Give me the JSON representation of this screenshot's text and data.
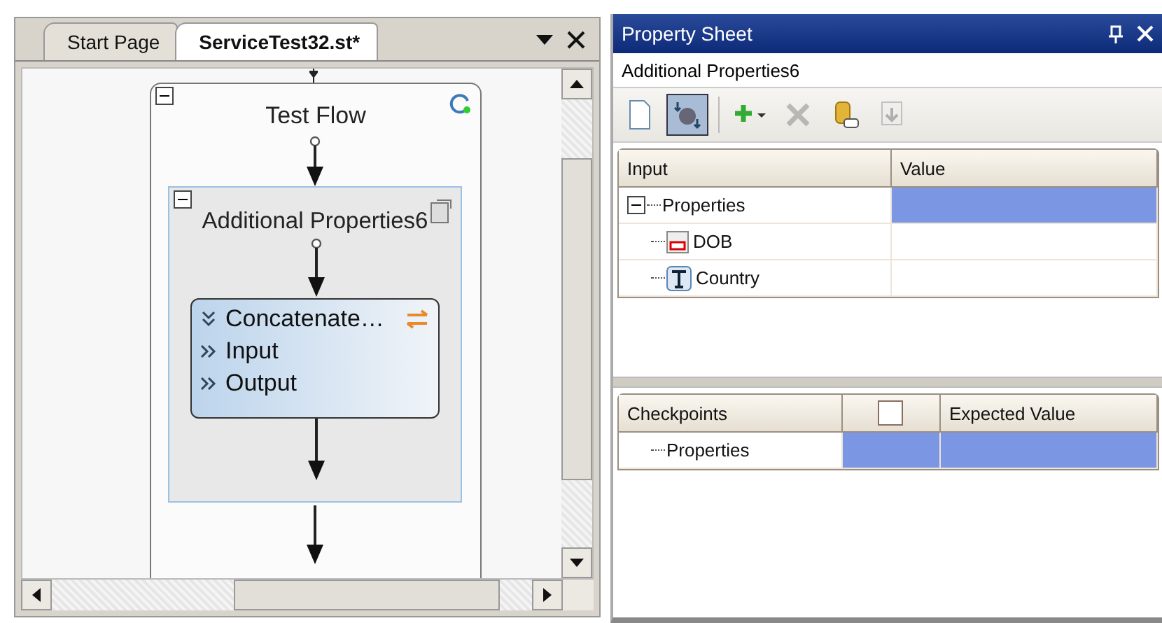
{
  "document_tabs": {
    "tabs": [
      {
        "label": "Start Page",
        "selected": false
      },
      {
        "label": "ServiceTest32.st*",
        "selected": true
      }
    ]
  },
  "diagram": {
    "flow": {
      "title": "Test Flow",
      "expanded": true
    },
    "group": {
      "title": "Additional Properties6",
      "expanded": true
    },
    "activity": {
      "title": "Concatenate…",
      "sections": [
        "Input",
        "Output"
      ]
    }
  },
  "property_sheet": {
    "title": "Property Sheet",
    "object_name": "Additional Properties6",
    "toolbar": [
      {
        "kind": "new",
        "pressed": false,
        "disabled": false
      },
      {
        "kind": "map",
        "pressed": true,
        "disabled": false
      },
      {
        "kind": "add",
        "pressed": false,
        "disabled": false
      },
      {
        "kind": "delete",
        "pressed": false,
        "disabled": true
      },
      {
        "kind": "link",
        "pressed": false,
        "disabled": false
      },
      {
        "kind": "import",
        "pressed": false,
        "disabled": true
      }
    ],
    "input_grid": {
      "columns": [
        "Input",
        "Value"
      ],
      "rows": [
        {
          "label": "Properties",
          "expanded": true,
          "selected": true,
          "children": [
            {
              "label": "DOB",
              "kind": "date",
              "selected": false
            },
            {
              "label": "Country",
              "kind": "text",
              "selected": false
            }
          ]
        }
      ]
    },
    "checkpoint_grid": {
      "columns": [
        "Checkpoints",
        "Expected Value"
      ],
      "header_checked": false,
      "rows": [
        {
          "label": "Properties",
          "selected": true
        }
      ]
    }
  }
}
